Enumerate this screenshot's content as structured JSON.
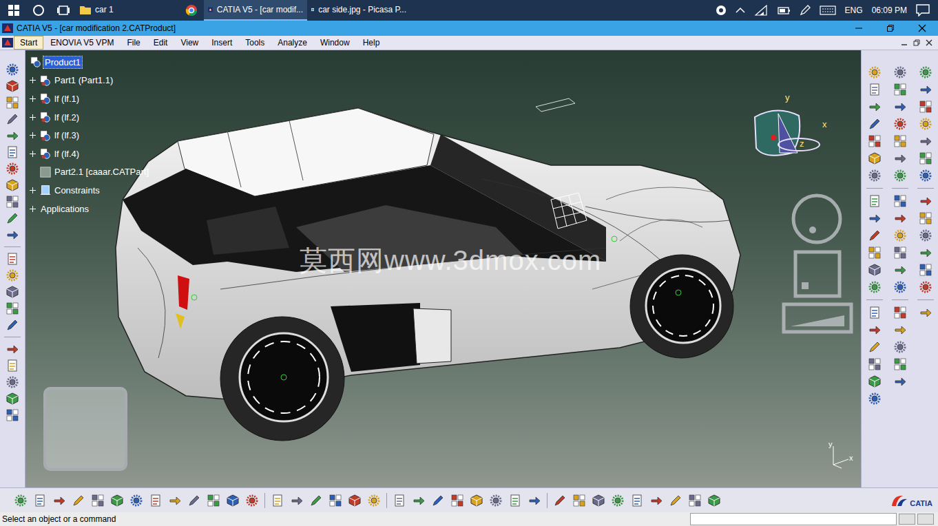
{
  "taskbar": {
    "apps": [
      {
        "label": "car 1",
        "kind": "folder",
        "selected": false
      },
      {
        "label": "CATIA V5 - [car modif...",
        "kind": "catia",
        "selected": true
      },
      {
        "label": "car side.jpg - Picasa P...",
        "kind": "picasa",
        "selected": false
      }
    ],
    "language": "ENG",
    "time": "06:09 PM"
  },
  "window": {
    "title": "CATIA V5 - [car modification 2.CATProduct]"
  },
  "menu": [
    {
      "label": "Start",
      "selected": true
    },
    {
      "label": "ENOVIA V5 VPM",
      "selected": false
    },
    {
      "label": "File",
      "selected": false
    },
    {
      "label": "Edit",
      "selected": false
    },
    {
      "label": "View",
      "selected": false
    },
    {
      "label": "Insert",
      "selected": false
    },
    {
      "label": "Tools",
      "selected": false
    },
    {
      "label": "Analyze",
      "selected": false
    },
    {
      "label": "Window",
      "selected": false
    },
    {
      "label": "Help",
      "selected": false
    }
  ],
  "tree": [
    {
      "label": "Product1",
      "kind": "product",
      "expander": false,
      "expanded": false,
      "selected": true
    },
    {
      "label": "Part1 (Part1.1)",
      "kind": "part",
      "expander": true,
      "expanded": false,
      "selected": false
    },
    {
      "label": "lf (lf.1)",
      "kind": "part",
      "expander": true,
      "expanded": false,
      "selected": false
    },
    {
      "label": "lf (lf.2)",
      "kind": "part",
      "expander": true,
      "expanded": false,
      "selected": false
    },
    {
      "label": "lf (lf.3)",
      "kind": "part",
      "expander": true,
      "expanded": false,
      "selected": false
    },
    {
      "label": "lf (lf.4)",
      "kind": "part",
      "expander": true,
      "expanded": false,
      "selected": false
    },
    {
      "label": "Part2.1 [caaar.CATPart]",
      "kind": "partfile",
      "expander": false,
      "expanded": false,
      "selected": false
    },
    {
      "label": "Constraints",
      "kind": "constraints",
      "expander": true,
      "expanded": false,
      "selected": false
    },
    {
      "label": "Applications",
      "kind": "applications",
      "expander": true,
      "expanded": false,
      "selected": false
    }
  ],
  "compass": {
    "y": "y",
    "x": "x",
    "z": "z"
  },
  "axes": {
    "y": "y",
    "x": "x"
  },
  "watermark": "莫西网www.3dmox.com",
  "status_bar": {
    "message": "Select an object or a command"
  },
  "logo": {
    "name": "CATIA"
  }
}
